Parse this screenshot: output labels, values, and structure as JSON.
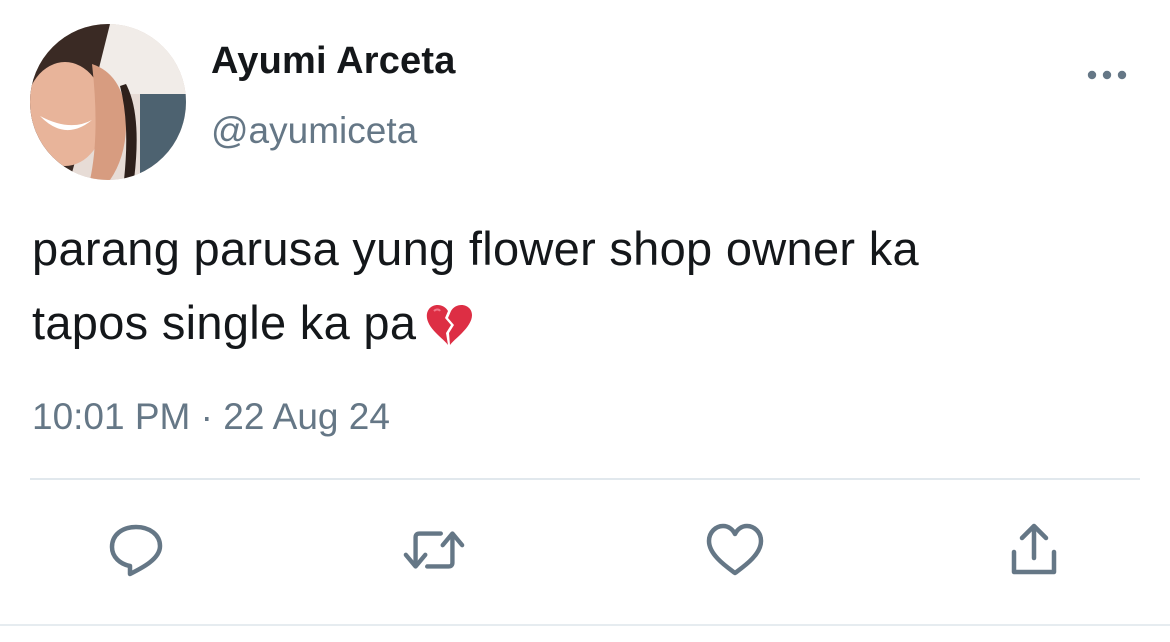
{
  "user": {
    "display_name": "Ayumi Arceta",
    "handle": "@ayumiceta"
  },
  "tweet": {
    "text_line_1": "parang parusa yung flower shop owner ka",
    "text_line_2": "tapos single ka pa",
    "emoji": "broken-heart",
    "timestamp": "10:01 PM · 22 Aug 24"
  },
  "actions": [
    "reply",
    "retweet",
    "like",
    "share"
  ],
  "icons": {
    "more": "more-icon",
    "reply": "reply-icon",
    "retweet": "retweet-icon",
    "like": "heart-icon",
    "share": "share-icon"
  },
  "colors": {
    "text": "#14171a",
    "secondary": "#657786",
    "divider": "#e1e8ed",
    "emoji_red": "#dd2e44"
  }
}
